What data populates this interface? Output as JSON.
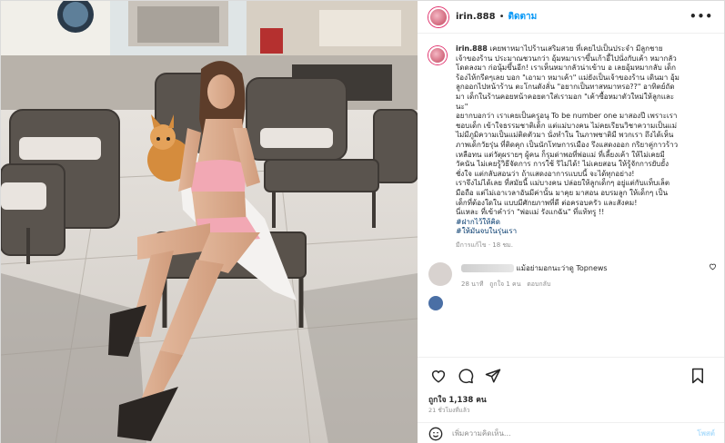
{
  "header": {
    "username": "irin.888",
    "separator": "•",
    "follow_label": "ติดตาม",
    "more": "•••"
  },
  "caption": {
    "username": "irin.888",
    "lines": [
      "เคยพาหมาไปร้านเสริมสวย ที่เคยไปเป็นประจำ มีลูกชาย",
      "เจ้าของร้าน ประมาณชวนกว่า อุ้มหมาเราขึ้นเก้าอี้ไปนั่งกับเค้า หมากลัว",
      "โดดลงมา ก่อนุ้มขึ้นอีก! เราเห็นหมากลัวน่าเข้าบ อ เลยอุ้มหมากลับ เด็ก",
      "ร้องไห้กรีดๆเลย บอก \"เอามา หมาเค้า\" แม่ยังเป็นเจ้าของร้าน เดินมา อุ้ม",
      "ลูกออกไปหน้าร้าน ตะโกนดังลั่น \"อยากเป็นทาสหมาหรอ??\" อาทิตย์ถัด",
      "มา เด็กในร้านคอยหน้าคอยตาใส่เรามอก \"เค้าซื้อหมาตัวใหม่ให้ลูกและ",
      "นะ\"",
      "อยากบอกว่า เราเคยเป็นครูอนุ To be number one มาสองปี เพราะเรา",
      "ชอบเด็ก เข้าใจธรรมชาติเด็ก แต่แม่บางคน ไม่คยเรียนวิชาความเป็นแม่",
      "ไม่มีภูมิความเป็นแม่ติดตัวมา นั่งทำใน ในภาพชาติมี พวกเรา ถึงได้เห็น",
      "ภาพเด็กวัยรุ่น ที่ติดคุก เป็นนักโทษการเมือง รึงแสดงออก กริยาคู่กาวร้าว",
      "เหลือทน แต่วัตุผรายๆ ผู้คน ก็รุมด่าพอที่พ่อแม่ ที่เลี้ยงเค้า ให้ไม่เคยมี",
      "วัคนัน ไม่เคยรู้วิธีจัดการ การใช้ ริไม่ได้! ไม่เคยสอน ให้รู้จักการยับยั้ง",
      "ชั่งใจ แต่กลับสอนว่า ถ้าแสดงอาการแบบนี้ จะได้ทุกอย่าง!",
      "เราจึงไม่ได้เลย ที่สมัยนี้ แม่บางคน ปล่อยให้ลูกเด็กๆ อยู่แต่กับแท็บเล็ต",
      "มือถือ แต่ไม่เอาเวลาอันมีค่านั้น มาคุย มาสอน อบรมลูก ให้เด็กๆ เป็น",
      "เด็กที่ต้องใดใน แบบมีศักยภาพที่ดี ต่อครอบครัว และสังคม!",
      "นี่แหละ ที่เข้าคำว่า \"พ่อแม่ รังแกฉัน\" ที่แท้ทรู !!"
    ],
    "hashtags": [
      "#ฝากไว้ให้คิด",
      "#ให้มันจบในรุ่นเรา"
    ],
    "meta": "มีการแก้ไข · 18 ชม."
  },
  "comment": {
    "text": "แม้อย่ามอกนะว่าดู Topnews",
    "time": "28 นาที",
    "likes": "ถูกใจ 1 คน",
    "reply": "ตอบกลับ"
  },
  "actions": {
    "like_icon": "heart-icon",
    "comment_icon": "comment-icon",
    "share_icon": "share-icon",
    "save_icon": "bookmark-icon"
  },
  "likes_label": "ถูกใจ 1,138 คน",
  "date_label": "21 ชั่วโมงที่แล้ว",
  "add_comment": {
    "placeholder": "เพิ่มความคิดเห็น...",
    "post_label": "โพสต์"
  },
  "colors": {
    "accent": "#0095f6",
    "hashtag": "#00376b",
    "muted": "#8e8e8e"
  }
}
